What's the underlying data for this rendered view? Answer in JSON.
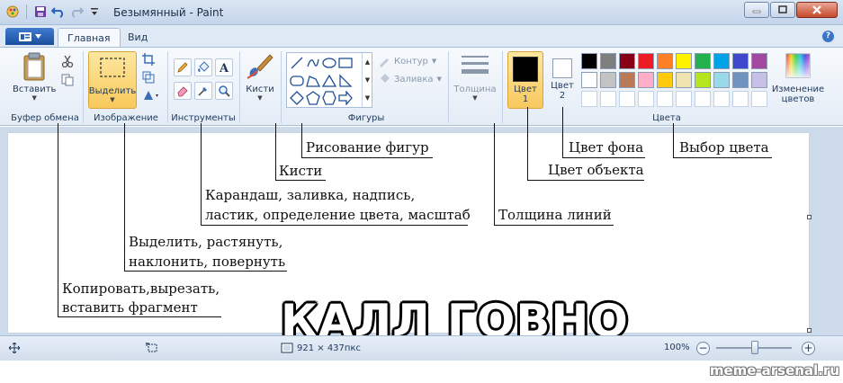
{
  "window": {
    "title": "Безымянный - Paint"
  },
  "tabs": {
    "home": "Главная",
    "view": "Вид"
  },
  "ribbon": {
    "clipboard": {
      "paste_label": "Вставить",
      "group_label": "Буфер обмена"
    },
    "image": {
      "select_label": "Выделить",
      "group_label": "Изображение"
    },
    "tools": {
      "group_label": "Инструменты"
    },
    "brushes": {
      "label": "Кисти"
    },
    "shapes": {
      "group_label": "Фигуры",
      "outline_label": "Контур",
      "fill_label": "Заливка"
    },
    "size": {
      "label": "Толщина"
    },
    "colors": {
      "color1_label": "Цвет",
      "color1_num": "1",
      "color2_label": "Цвет",
      "color2_num": "2",
      "edit_label_1": "Изменение",
      "edit_label_2": "цветов",
      "group_label": "Цвета",
      "color1_value": "#000000",
      "color2_value": "#ffffff",
      "palette_row1": [
        "#000000",
        "#7f7f7f",
        "#880015",
        "#ed1c24",
        "#ff7f27",
        "#fff200",
        "#22b14c",
        "#00a2e8",
        "#3f48cc",
        "#a349a4"
      ],
      "palette_row2": [
        "#ffffff",
        "#c3c3c3",
        "#b97a57",
        "#ffaec9",
        "#ffc90e",
        "#efe4b0",
        "#b5e61d",
        "#99d9ea",
        "#7092be",
        "#c8bfe7"
      ],
      "palette_row3": [
        "#ffffff",
        "#ffffff",
        "#ffffff",
        "#ffffff",
        "#ffffff",
        "#ffffff",
        "#ffffff",
        "#ffffff",
        "#ffffff",
        "#ffffff"
      ]
    }
  },
  "annotations": {
    "draw_shapes": "Рисование фигур",
    "brushes": "Кисти",
    "tools_line1": "Карандаш, заливка, надпись,",
    "tools_line2": "ластик, определение цвета, масштаб",
    "select_line1": "Выделить, растянуть,",
    "select_line2": "наклонить, повернуть",
    "clipboard_line1": "Копировать,вырезать,",
    "clipboard_line2": "вставить фрагмент",
    "bg_color": "Цвет фона",
    "obj_color": "Цвет объекта",
    "line_width": "Толщина линий",
    "pick_color": "Выбор цвета"
  },
  "meme_caption": "КАЛЛ ГОВНО",
  "status": {
    "canvas_size": "921 × 437пкс",
    "zoom": "100%"
  },
  "watermark": "meme-arsenal.ru"
}
